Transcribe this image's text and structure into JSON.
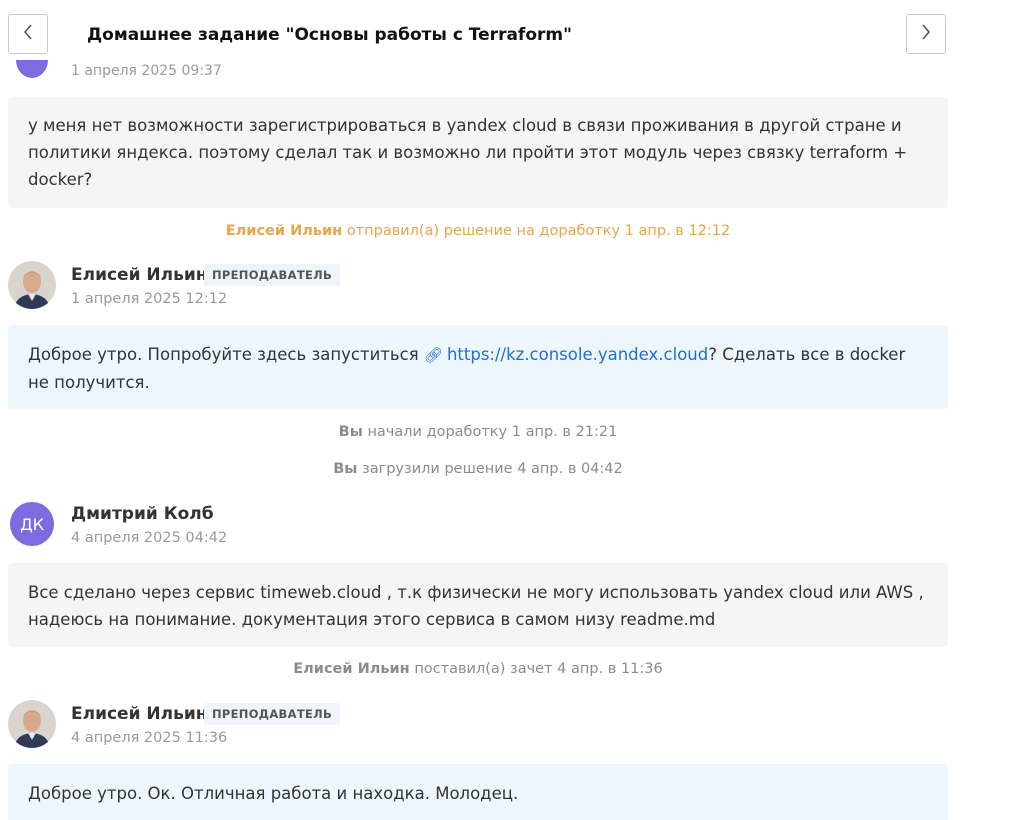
{
  "header": {
    "title": "Домашнее задание \"Основы работы с Terraform\"",
    "prev_icon": "chevron-left-icon",
    "next_icon": "chevron-right-icon"
  },
  "clipped_item": {
    "date": "1 апреля 2025 09:37"
  },
  "messages": [
    {
      "text": "у меня нет возможности зарегистрироваться в yandex cloud в связи проживания в другой стране и политики яндекса. поэтому сделал так и возможно ли пройти этот модуль через связку terraform + docker?"
    },
    {
      "author": "Елисей Ильин",
      "role": "ПРЕПОДАВАТЕЛЬ",
      "date": "1 апреля 2025 12:12",
      "text_before": "Доброе утро. Попробуйте здесь запуститься",
      "link_icon": "link-icon",
      "link": "https://kz.console.yandex.cloud",
      "text_after": "? Сделать все в docker не получится."
    },
    {
      "author": "Дмитрий Колб",
      "initials": "ДК",
      "date": "4 апреля 2025 04:42",
      "text": "Все сделано через сервис timeweb.cloud , т.к физически не могу использовать yandex cloud или AWS , надеюсь на понимание. документация этого сервиса в самом низу readme.md"
    },
    {
      "author": "Елисей Ильин",
      "role": "ПРЕПОДАВАТЕЛЬ",
      "date": "4 апреля 2025 11:36",
      "text": "Доброе утро. Ок. Отличная работа и находка. Молодец."
    }
  ],
  "events": [
    {
      "actor": "Елисей Ильин",
      "text": "отправил(а) решение на доработку 1 апр. в 12:12",
      "color": "#e8a54a"
    },
    {
      "actor": "Вы",
      "text": "начали доработку 1 апр. в 21:21"
    },
    {
      "actor": "Вы",
      "text": "загрузили решение 4 апр. в 04:42"
    },
    {
      "actor": "Елисей Ильин",
      "text": "поставил(а) зачет 4 апр. в 11:36"
    }
  ]
}
